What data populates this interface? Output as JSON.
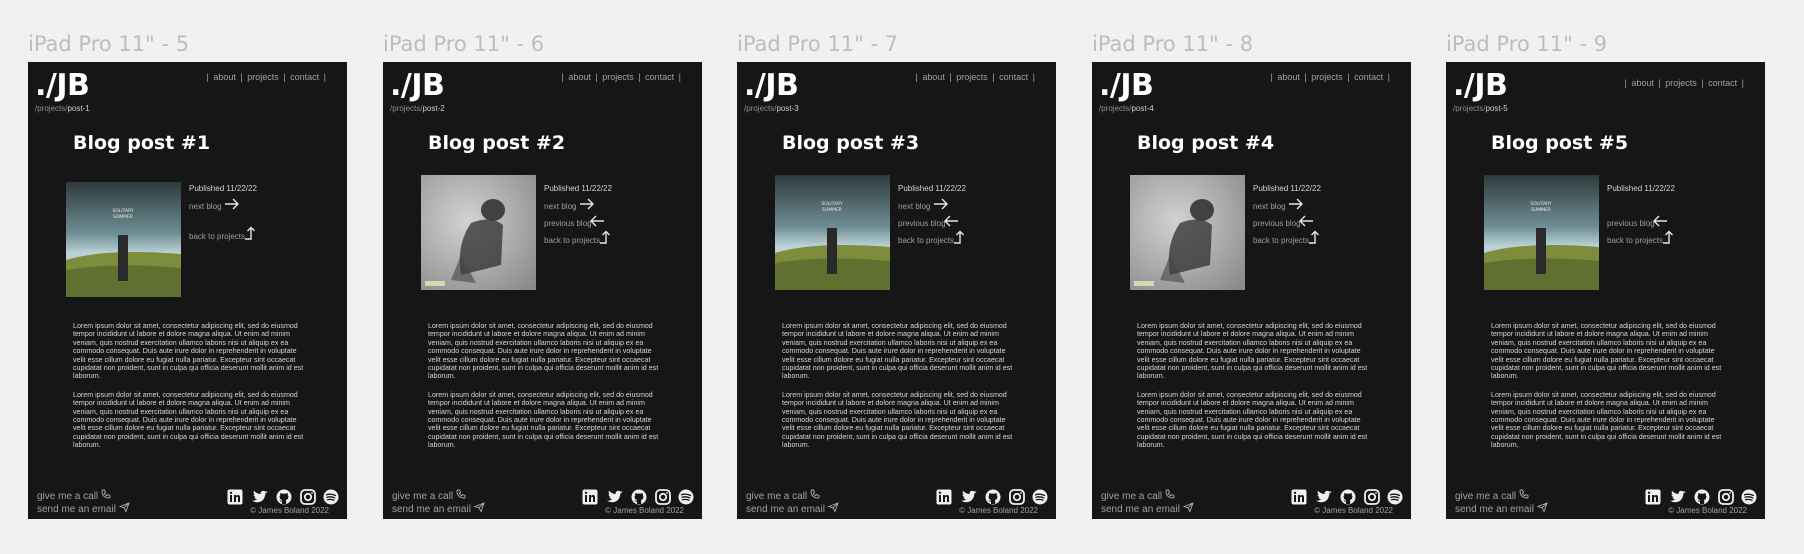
{
  "frames": [
    {
      "label": "iPad Pro 11\" - 5",
      "post_slug": "post-1",
      "title": "Blog post #1",
      "cover": "Soft Summer album cover"
    },
    {
      "label": "iPad Pro 11\" - 6",
      "post_slug": "post-2",
      "title": "Blog post #2",
      "cover": "Blurred figure album cover"
    },
    {
      "label": "iPad Pro 11\" - 7",
      "post_slug": "post-3",
      "title": "Blog post #3",
      "cover": "Soft Summer album cover"
    },
    {
      "label": "iPad Pro 11\" - 8",
      "post_slug": "post-4",
      "title": "Blog post #4",
      "cover": "Blurred figure album cover"
    },
    {
      "label": "iPad Pro 11\" - 9",
      "post_slug": "post-5",
      "title": "Blog post #5",
      "cover": "Soft Summer album cover"
    }
  ],
  "site": {
    "logo": "./JB",
    "crumb_projects": "/projects/",
    "nav": {
      "sep": "|",
      "about": "about",
      "projects": "projects",
      "contact": "contact"
    },
    "published": "Published 11/22/22",
    "next_blog": "next blog",
    "previous_blog": "previous blog",
    "back_to_projects": "back to projects",
    "paragraph1": "Lorem ipsum dolor sit amet, consectetur adipiscing elit, sed do eiusmod tempor incididunt ut labore et dolore magna aliqua. Ut enim ad minim veniam, quis nostrud exercitation ullamco laboris nisi ut aliquip ex ea commodo consequat. Duis aute irure dolor in reprehenderit in voluptate velit esse cillum dolore eu fugiat nulla pariatur. Excepteur sint occaecat cupidatat non proident, sunt in culpa qui officia deserunt mollit anim id est laborum.",
    "paragraph2": "Lorem ipsum dolor sit amet, consectetur adipiscing elit, sed do eiusmod tempor incididunt ut labore et dolore magna aliqua. Ut enim ad minim veniam, quis nostrud exercitation ullamco laboris nisi ut aliquip ex ea commodo consequat. Duis aute irure dolor in reprehenderit in voluptate velit esse cillum dolore eu fugiat nulla pariatur. Excepteur sint occaecat cupidatat non proident, sunt in culpa qui officia deserunt mollit anim id est laborum.",
    "give_call": "give me a call",
    "send_email": "send me an email",
    "copyright": "© James Boland 2022",
    "social_icons": [
      "linkedin-icon",
      "twitter-icon",
      "github-icon",
      "instagram-icon",
      "spotify-icon"
    ],
    "colors": {
      "frame_bg": "#161616",
      "canvas_bg": "#f1f1f1",
      "link": "#8fa2aa"
    }
  }
}
